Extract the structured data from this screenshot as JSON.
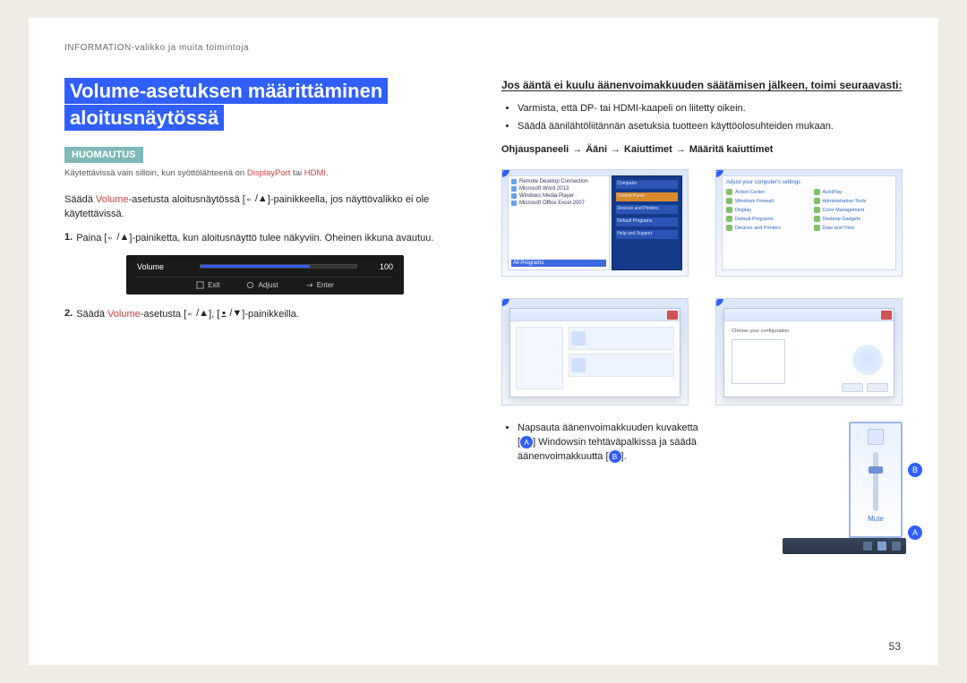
{
  "header": {
    "path": "INFORMATION-valikko ja muita toimintoja"
  },
  "left": {
    "heading_l1": "Volume-asetuksen määrittäminen",
    "heading_l2": "aloitusnäytössä",
    "note_badge": "HUOMAUTUS",
    "note_pre": "Käytettävissä vain silloin, kun syöttölähteenä on ",
    "note_dp": "DisplayPort",
    "note_or": " tai ",
    "note_hdmi": "HDMI",
    "note_end": ".",
    "para_pre": "Säädä ",
    "para_vol": "Volume",
    "para_post": "-asetusta aloitusnäytössä [",
    "para_after_key": "]-painikkeella, jos näyttövalikko ei ole käytettävissä.",
    "step1_num": "1.",
    "step1_pre": "Paina [",
    "step1_post": "]-painiketta, kun aloitusnäyttö tulee näkyviin. Oheinen ikkuna avautuu.",
    "osd": {
      "label": "Volume",
      "value": "100",
      "exit": "Exit",
      "adjust": "Adjust",
      "enter": "Enter"
    },
    "step2_num": "2.",
    "step2_pre": "Säädä ",
    "step2_vol": "Volume",
    "step2_mid1": "-asetusta [",
    "step2_mid2": "], [",
    "step2_end": "]-painikkeilla."
  },
  "right": {
    "heading": "Jos ääntä ei kuulu äänenvoimakkuuden säätämisen jälkeen, toimi seuraavasti:",
    "b1": "Varmista, että DP- tai HDMI-kaapeli on liitetty oikein.",
    "b2": "Säädä äänilähtöliitännän asetuksia tuotteen käyttöolosuhteiden mukaan.",
    "path": {
      "p1": "Ohjauspaneeli",
      "p2": "Ääni",
      "p3": "Kaiuttimet",
      "p4": "Määritä kaiuttimet"
    },
    "badges": {
      "s1": "1",
      "s2": "2",
      "s3": "3",
      "s4": "4"
    },
    "bottom": {
      "line1": "Napsauta äänenvoimakkuuden kuvaketta",
      "line2a": "[",
      "line2b": "] Windowsin tehtäväpalkissa ja säädä",
      "line3a": "äänenvoimakkuutta [",
      "line3b": "].",
      "letterA": "A",
      "letterB": "B",
      "mute": "Mute"
    }
  },
  "page_number": "53",
  "shot1_menu": [
    "Remote Desktop Connection",
    "Microsoft Word 2013",
    "Windows Media Player",
    "Microsoft Office Excel 2007"
  ],
  "shot1_all": "All Programs",
  "shot1_tiles": [
    "Computer",
    "Control Panel",
    "Devices and Printers",
    "Default Programs",
    "Help and Support"
  ],
  "shot2_items": [
    "Action Center",
    "AutoPlay",
    "Windows Firewall",
    "Administrative Tools",
    "Display",
    "Color Management",
    "Default Programs",
    "Desktop Gadgets",
    "Devices and Printers",
    "Date and Time"
  ]
}
